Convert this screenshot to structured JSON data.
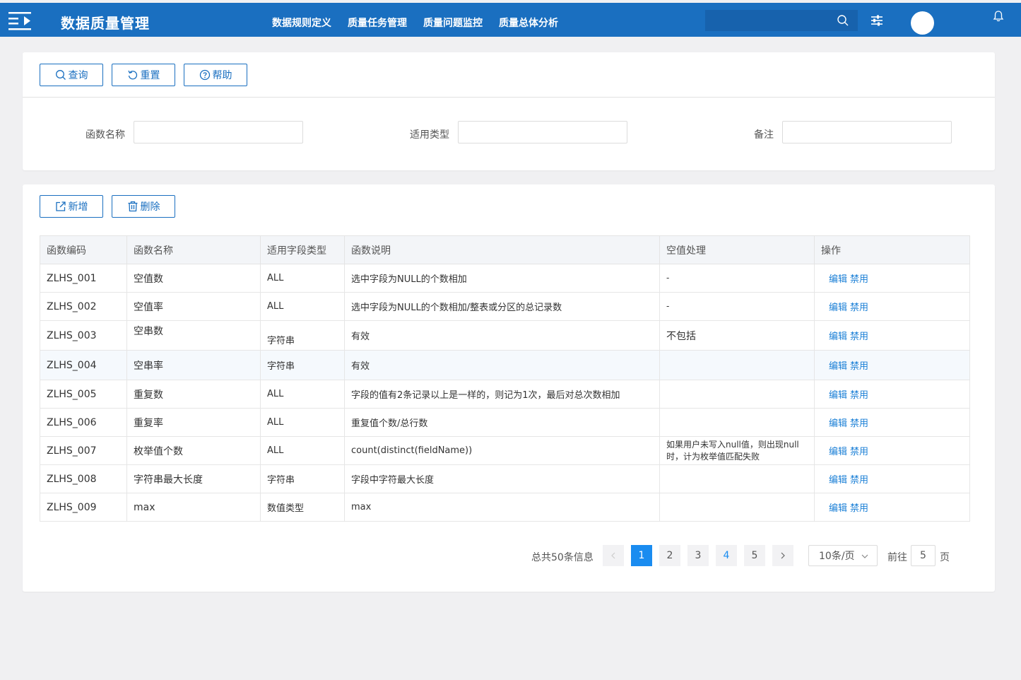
{
  "app": {
    "title": "数据质量管理"
  },
  "nav": [
    "数据规则定义",
    "质量任务管理",
    "质量问题监控",
    "质量总体分析"
  ],
  "search": {
    "placeholder": ""
  },
  "toolbar": {
    "query": "查询",
    "reset": "重置",
    "help": "帮助"
  },
  "filters": {
    "func_name": {
      "label": "函数名称",
      "value": ""
    },
    "apply_type": {
      "label": "适用类型",
      "value": ""
    },
    "remark": {
      "label": "备注",
      "value": ""
    }
  },
  "actions": {
    "add": "新增",
    "delete": "删除"
  },
  "table": {
    "columns": [
      "函数编码",
      "函数名称",
      "适用字段类型",
      "函数说明",
      "空值处理",
      "操作"
    ],
    "op_edit": "编辑",
    "op_disable": "禁用",
    "rows": [
      {
        "code": "ZLHS_001",
        "name": "空值数",
        "type": "ALL",
        "desc": "选中字段为NULL的个数相加",
        "null": "-"
      },
      {
        "code": "ZLHS_002",
        "name": "空值率",
        "type": "ALL",
        "desc": "选中字段为NULL的个数相加/整表或分区的总记录数",
        "null": "-"
      },
      {
        "code": "ZLHS_003",
        "name": "空串数",
        "type": "字符串",
        "desc": "有效",
        "null": "不包括"
      },
      {
        "code": "ZLHS_004",
        "name": "空串率",
        "type": "字符串",
        "desc": "有效",
        "null": ""
      },
      {
        "code": "ZLHS_005",
        "name": "重复数",
        "type": "ALL",
        "desc": "字段的值有2条记录以上是一样的，则记为1次，最后对总次数相加",
        "null": ""
      },
      {
        "code": "ZLHS_006",
        "name": "重复率",
        "type": "ALL",
        "desc": "重复值个数/总行数",
        "null": ""
      },
      {
        "code": "ZLHS_007",
        "name": "枚举值个数",
        "type": "ALL",
        "desc": "count(distinct(fieldName))",
        "null": "如果用户未写入null值，则出现null时，计为枚举值匹配失败"
      },
      {
        "code": "ZLHS_008",
        "name": "字符串最大长度",
        "type": "字符串",
        "desc": "字段中字符最大长度",
        "null": ""
      },
      {
        "code": "ZLHS_009",
        "name": "max",
        "type": "数值类型",
        "desc": "max",
        "null": ""
      }
    ]
  },
  "pagination": {
    "total": "总共50条信息",
    "pages": [
      "1",
      "2",
      "3",
      "4",
      "5"
    ],
    "current": "1",
    "page_size": "10条/页",
    "goto_label": "前往",
    "goto_value": "5",
    "page_suffix": "页"
  }
}
